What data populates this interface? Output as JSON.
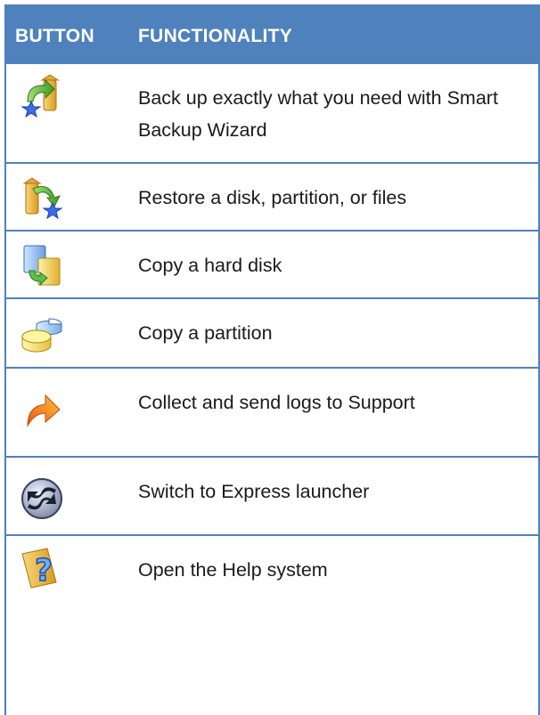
{
  "header": {
    "col_button": "BUTTON",
    "col_functionality": "FUNCTIONALITY"
  },
  "rows": [
    {
      "icon": "backup-wizard-icon",
      "text": "Back up exactly what you need with Smart Backup Wizard"
    },
    {
      "icon": "restore-icon",
      "text": "Restore a disk, partition, or files"
    },
    {
      "icon": "copy-hard-disk-icon",
      "text": "Copy a hard disk"
    },
    {
      "icon": "copy-partition-icon",
      "text": "Copy a partition"
    },
    {
      "icon": "send-logs-icon",
      "text": "Collect and send logs to Support"
    },
    {
      "icon": "express-launcher-icon",
      "text": "Switch to Express launcher"
    },
    {
      "icon": "help-system-icon",
      "text": "Open the Help system"
    }
  ],
  "colors": {
    "header_bg": "#4f81bd",
    "header_text": "#ffffff",
    "border": "#4f81bd"
  }
}
